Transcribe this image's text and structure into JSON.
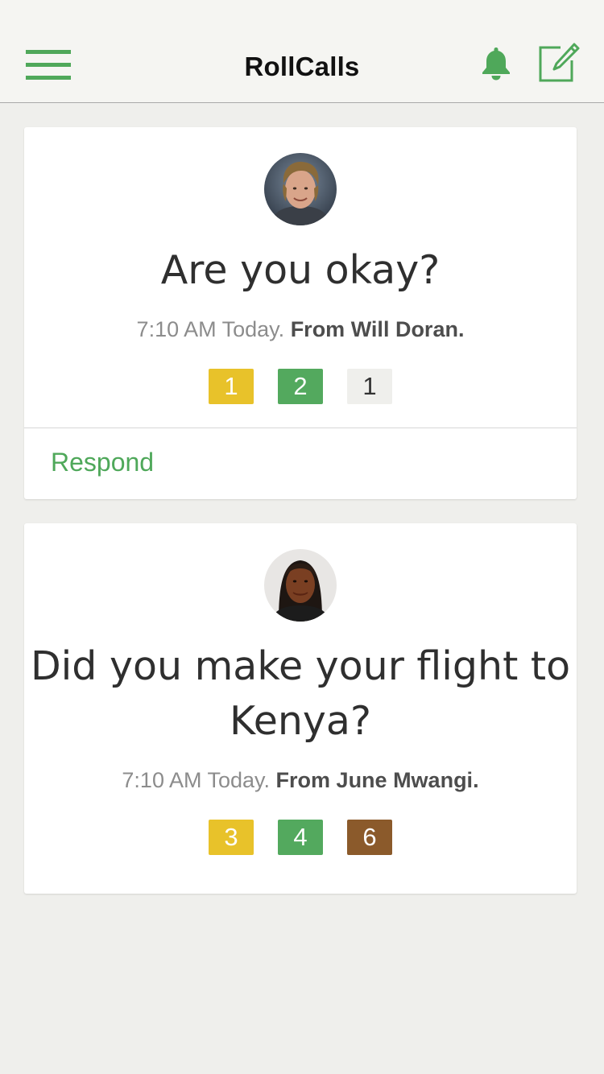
{
  "app": {
    "title": "RollCalls",
    "accent_color": "#4fa85a",
    "icons": {
      "menu": "hamburger-menu-icon",
      "notifications": "bell-icon",
      "compose": "compose-icon"
    }
  },
  "rollcalls": [
    {
      "question": "Are you okay?",
      "time": "7:10 AM Today.",
      "from": "From Will Doran.",
      "avatar": "avatar-will-doran",
      "counts": [
        {
          "value": "1",
          "color": "#e8c22a",
          "text_color": "#ffffff"
        },
        {
          "value": "2",
          "color": "#53a95e",
          "text_color": "#ffffff"
        },
        {
          "value": "1",
          "color": "#efefec",
          "text_color": "#333333"
        }
      ],
      "action": "Respond"
    },
    {
      "question": "Did you make your flight to Kenya?",
      "time": "7:10 AM Today.",
      "from": "From June Mwangi.",
      "avatar": "avatar-june-mwangi",
      "counts": [
        {
          "value": "3",
          "color": "#e8c22a",
          "text_color": "#ffffff"
        },
        {
          "value": "4",
          "color": "#53a95e",
          "text_color": "#ffffff"
        },
        {
          "value": "6",
          "color": "#8b5a2b",
          "text_color": "#ffffff"
        }
      ]
    }
  ]
}
